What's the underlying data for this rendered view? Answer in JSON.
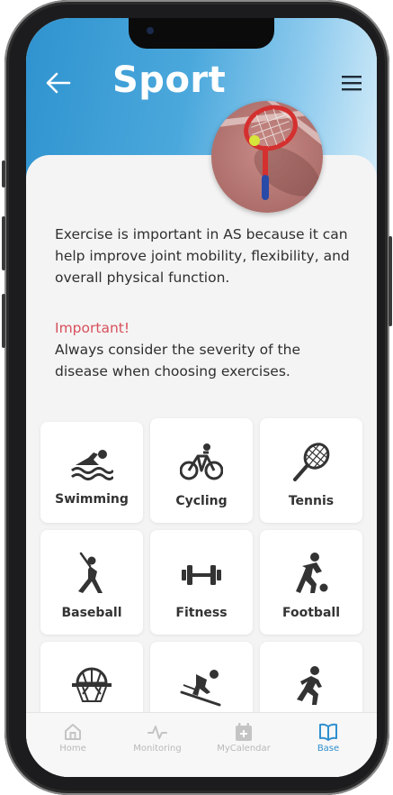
{
  "header": {
    "title": "Sport",
    "back_icon": "arrow-left-icon",
    "menu_icon": "hamburger-menu-icon",
    "image": "tennis-racket-photo"
  },
  "intro": {
    "text": "Exercise is important in AS because it can help improve joint mobility, flexibility, and overall physical function."
  },
  "notice": {
    "heading": "Important!",
    "text": "Always consider the severity of the disease when choosing exercises.",
    "heading_color": "#d8505c"
  },
  "sports": [
    {
      "label": "Swimming",
      "icon": "swimmer-icon"
    },
    {
      "label": "Cycling",
      "icon": "bicycle-icon"
    },
    {
      "label": "Tennis",
      "icon": "tennis-racket-icon"
    },
    {
      "label": "Baseball",
      "icon": "baseball-player-icon"
    },
    {
      "label": "Fitness",
      "icon": "dumbbell-icon"
    },
    {
      "label": "Football",
      "icon": "football-player-icon"
    },
    {
      "label": "",
      "icon": "basketball-hoop-icon"
    },
    {
      "label": "",
      "icon": "skier-icon"
    },
    {
      "label": "",
      "icon": "runner-icon"
    }
  ],
  "tabbar": {
    "tabs": [
      {
        "label": "Home",
        "icon": "home-icon",
        "active": false
      },
      {
        "label": "Monitoring",
        "icon": "pulse-icon",
        "active": false
      },
      {
        "label": "MyCalendar",
        "icon": "calendar-add-icon",
        "active": false
      },
      {
        "label": "Base",
        "icon": "book-icon",
        "active": true
      }
    ],
    "active_color": "#2f8fcf",
    "inactive_color": "#b9b9b9"
  },
  "colors": {
    "header_gradient_start": "#2f93cf",
    "header_gradient_end": "#d8eef9",
    "background": "#f4f4f4"
  }
}
